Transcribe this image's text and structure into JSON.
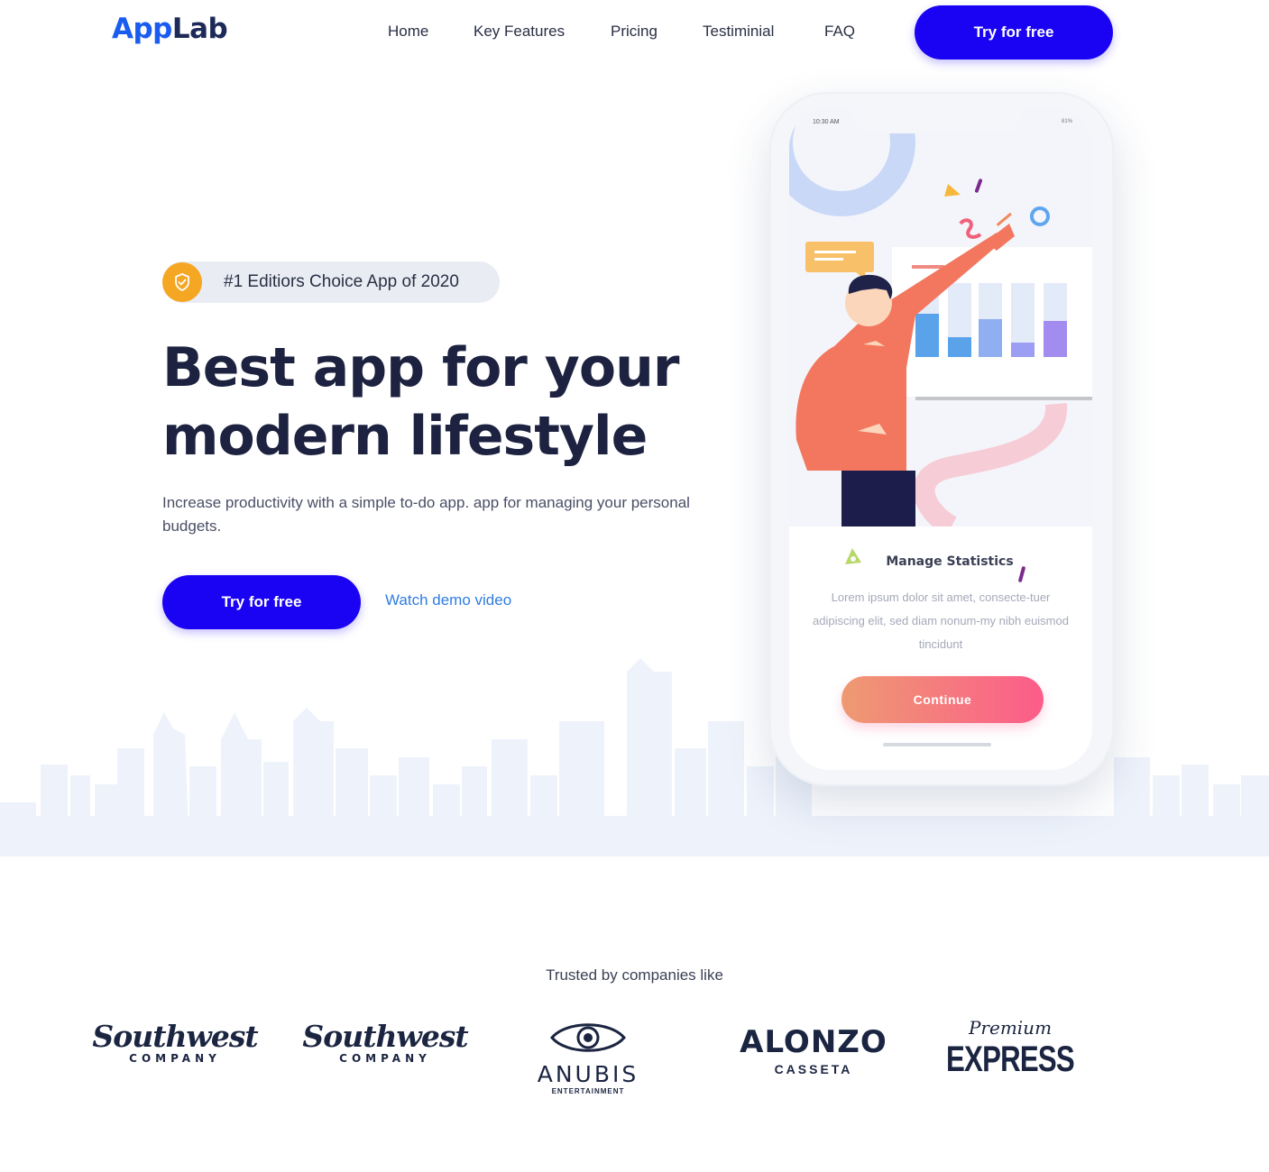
{
  "brand": {
    "logo_part1": "App",
    "logo_part2": "Lab"
  },
  "nav": {
    "links": [
      "Home",
      "Key Features",
      "Pricing",
      "Testiminial",
      "FAQ"
    ],
    "cta_label": "Try for free"
  },
  "hero": {
    "badge_text": "#1 Editiors Choice App of 2020",
    "title_line1": "Best app for your",
    "title_line2": "modern lifestyle",
    "subtitle": "Increase productivity with a simple to-do app. app for managing your personal budgets.",
    "cta_label": "Try for free",
    "secondary_link": "Watch demo video"
  },
  "phone": {
    "status_time": "10:30 AM",
    "status_right": "81%",
    "card_title": "Manage Statistics",
    "card_text": "Lorem ipsum dolor sit amet, consecte-tuer adipiscing elit, sed diam nonum-my nibh euismod tincidunt",
    "continue_label": "Continue"
  },
  "trusted": {
    "heading": "Trusted by companies like",
    "logos": [
      {
        "name": "Southwest",
        "sub": "COMPANY"
      },
      {
        "name": "Southwest",
        "sub": "COMPANY"
      },
      {
        "name": "ANUBIS",
        "sub": "ENTERTAINMENT"
      },
      {
        "name": "ALONZO",
        "sub": "CASSETA"
      },
      {
        "name": "EXPRESS",
        "sub": "Premium"
      }
    ]
  },
  "colors": {
    "primary": "#1a03f3",
    "dark_text": "#1d2240",
    "link": "#2f7de1",
    "badge_icon": "#f5a623",
    "continue_gradient_start": "#ee9a72",
    "continue_gradient_end": "#fc5c8a",
    "skyline": "#eef3fb"
  }
}
